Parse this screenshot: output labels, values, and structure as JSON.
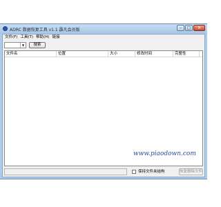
{
  "window": {
    "title": "ADRC 数据恢复工具 v1.1 霹凡会员版",
    "minimize_label": "–",
    "maximize_label": "□",
    "close_label": "✕"
  },
  "menu": {
    "items": [
      {
        "label": "文件(F)"
      },
      {
        "label": "工具(T)"
      },
      {
        "label": "帮助(H)"
      },
      {
        "label": "链接"
      }
    ]
  },
  "toolbar": {
    "drive_selected": "",
    "search_label": "搜索"
  },
  "table": {
    "columns": [
      "文件名",
      "位置",
      "大小",
      "修改时间",
      "完整性"
    ],
    "rows": []
  },
  "watermark": "www.piaodown.com",
  "bottom": {
    "status_text": "",
    "keep_structure_label": "保持文件夹结构",
    "keep_structure_checked": false,
    "restore_label": "恢复删除文件"
  }
}
